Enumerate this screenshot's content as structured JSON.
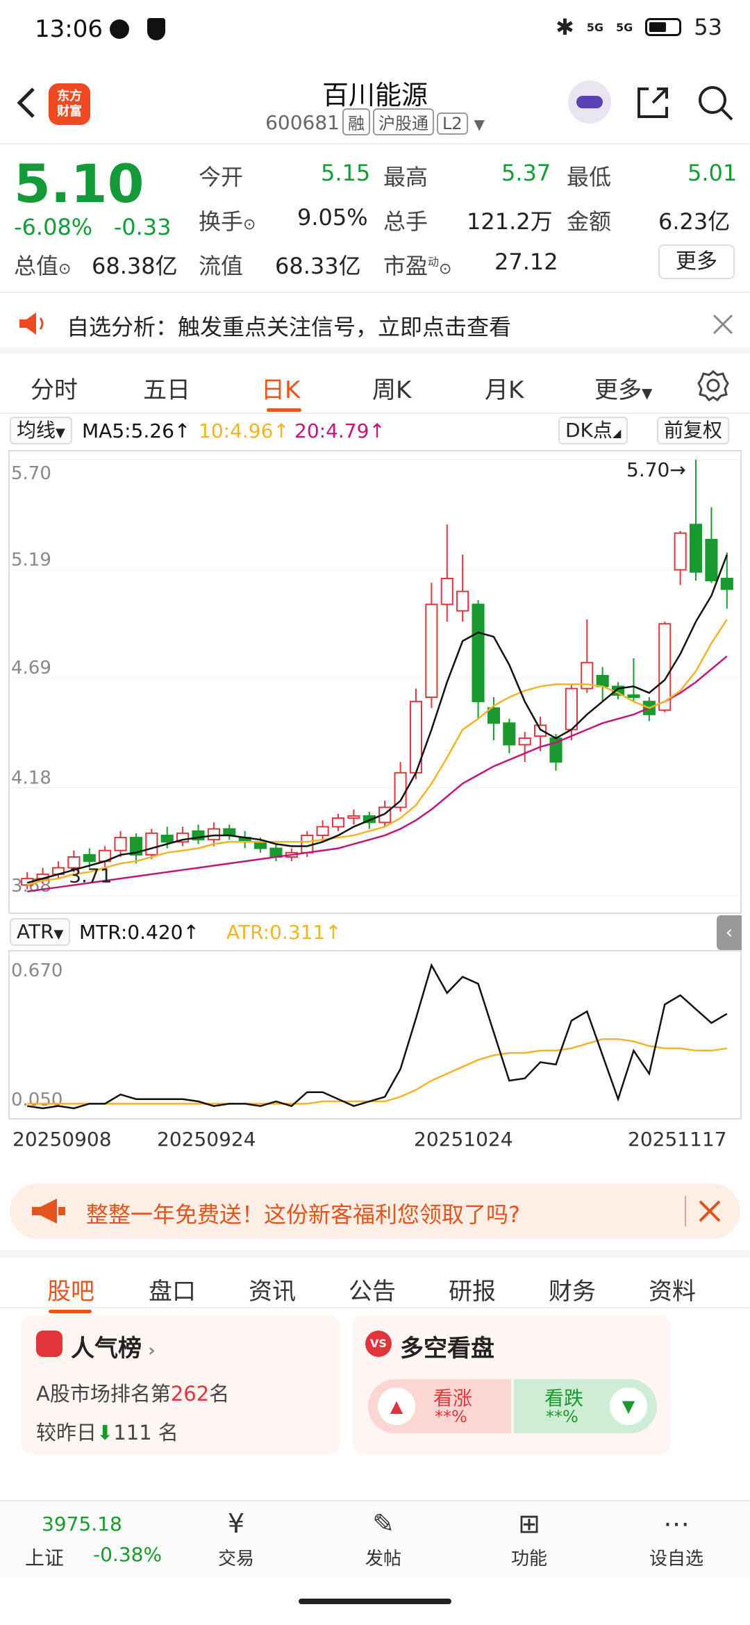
{
  "status": {
    "time": "13:06",
    "battery": "53",
    "net1": "5G",
    "net2": "5G"
  },
  "header": {
    "title": "百川能源",
    "code": "600681",
    "tags": [
      "融",
      "沪股通",
      "L2"
    ],
    "logo_line1": "东方",
    "logo_line2": "财富"
  },
  "quote": {
    "price": "5.10",
    "change_pct": "-6.08%",
    "change_abs": "-0.33",
    "open_label": "今开",
    "open": "5.15",
    "high_label": "最高",
    "high": "5.37",
    "low_label": "最低",
    "low": "5.01",
    "turnover_label": "换手",
    "turnover": "9.05%",
    "volume_label": "总手",
    "volume": "121.2万",
    "amount_label": "金额",
    "amount": "6.23亿",
    "mcap_label": "总值",
    "mcap": "68.38亿",
    "float_label": "流值",
    "float": "68.33亿",
    "pe_label": "市盈",
    "pe_sup": "动",
    "pe": "27.12",
    "more": "更多"
  },
  "notice": {
    "text": "自选分析：触发重点关注信号，立即点击查看"
  },
  "tabs": [
    "分时",
    "五日",
    "日K",
    "周K",
    "月K",
    "更多"
  ],
  "indicators": {
    "ma_selector": "均线",
    "ma5": "MA5:5.26↑",
    "ma10": "10:4.96↑",
    "ma20": "20:4.79↑",
    "dk": "DK点",
    "adjust": "前复权",
    "colors": {
      "ma5": "#111111",
      "ma10": "#f0b429",
      "ma20": "#c2157a",
      "up": "#e0353b",
      "down": "#1a9a2e"
    }
  },
  "atr": {
    "selector": "ATR",
    "mtr": "MTR:0.420↑",
    "atr": "ATR:0.311↑",
    "y_labels": [
      "0.670",
      "0.050"
    ]
  },
  "date_labels": [
    "20250908",
    "20250924",
    "20251024",
    "20251117"
  ],
  "chart_data": {
    "type": "candlestick",
    "ylim": [
      3.68,
      5.7
    ],
    "y_ticks": [
      "5.70",
      "5.19",
      "4.69",
      "4.18",
      "3.68"
    ],
    "max_label": "5.70→",
    "min_label": "3.71",
    "candles": [
      {
        "o": 3.73,
        "c": 3.76,
        "h": 3.79,
        "l": 3.71
      },
      {
        "o": 3.76,
        "c": 3.78,
        "h": 3.81,
        "l": 3.74
      },
      {
        "o": 3.78,
        "c": 3.81,
        "h": 3.84,
        "l": 3.76
      },
      {
        "o": 3.81,
        "c": 3.86,
        "h": 3.89,
        "l": 3.79
      },
      {
        "o": 3.87,
        "c": 3.84,
        "h": 3.9,
        "l": 3.81
      },
      {
        "o": 3.84,
        "c": 3.89,
        "h": 3.91,
        "l": 3.8
      },
      {
        "o": 3.89,
        "c": 3.95,
        "h": 3.98,
        "l": 3.86
      },
      {
        "o": 3.95,
        "c": 3.87,
        "h": 3.97,
        "l": 3.83
      },
      {
        "o": 3.87,
        "c": 3.97,
        "h": 3.99,
        "l": 3.85
      },
      {
        "o": 3.96,
        "c": 3.93,
        "h": 4.0,
        "l": 3.9
      },
      {
        "o": 3.93,
        "c": 3.97,
        "h": 4.0,
        "l": 3.91
      },
      {
        "o": 3.98,
        "c": 3.94,
        "h": 4.01,
        "l": 3.92
      },
      {
        "o": 3.94,
        "c": 3.99,
        "h": 4.02,
        "l": 3.91
      },
      {
        "o": 3.99,
        "c": 3.96,
        "h": 4.01,
        "l": 3.94
      },
      {
        "o": 3.95,
        "c": 3.93,
        "h": 3.98,
        "l": 3.9
      },
      {
        "o": 3.93,
        "c": 3.9,
        "h": 3.95,
        "l": 3.88
      },
      {
        "o": 3.9,
        "c": 3.86,
        "h": 3.92,
        "l": 3.84
      },
      {
        "o": 3.86,
        "c": 3.88,
        "h": 3.9,
        "l": 3.84
      },
      {
        "o": 3.88,
        "c": 3.96,
        "h": 3.98,
        "l": 3.86
      },
      {
        "o": 3.96,
        "c": 4.0,
        "h": 4.03,
        "l": 3.93
      },
      {
        "o": 4.0,
        "c": 4.04,
        "h": 4.06,
        "l": 3.98
      },
      {
        "o": 4.04,
        "c": 4.05,
        "h": 4.08,
        "l": 4.01
      },
      {
        "o": 4.05,
        "c": 4.02,
        "h": 4.07,
        "l": 3.99
      },
      {
        "o": 4.02,
        "c": 4.09,
        "h": 4.12,
        "l": 4.0
      },
      {
        "o": 4.09,
        "c": 4.25,
        "h": 4.3,
        "l": 4.07
      },
      {
        "o": 4.25,
        "c": 4.58,
        "h": 4.64,
        "l": 4.22
      },
      {
        "o": 4.6,
        "c": 5.03,
        "h": 5.13,
        "l": 4.55
      },
      {
        "o": 5.03,
        "c": 5.15,
        "h": 5.4,
        "l": 4.95
      },
      {
        "o": 5.0,
        "c": 5.09,
        "h": 5.26,
        "l": 4.95
      },
      {
        "o": 5.03,
        "c": 4.58,
        "h": 5.05,
        "l": 4.5
      },
      {
        "o": 4.55,
        "c": 4.48,
        "h": 4.6,
        "l": 4.4
      },
      {
        "o": 4.48,
        "c": 4.38,
        "h": 4.5,
        "l": 4.34
      },
      {
        "o": 4.38,
        "c": 4.41,
        "h": 4.44,
        "l": 4.3
      },
      {
        "o": 4.42,
        "c": 4.47,
        "h": 4.51,
        "l": 4.35
      },
      {
        "o": 4.41,
        "c": 4.3,
        "h": 4.43,
        "l": 4.26
      },
      {
        "o": 4.45,
        "c": 4.64,
        "h": 4.66,
        "l": 4.4
      },
      {
        "o": 4.64,
        "c": 4.76,
        "h": 4.96,
        "l": 4.62
      },
      {
        "o": 4.7,
        "c": 4.65,
        "h": 4.74,
        "l": 4.58
      },
      {
        "o": 4.65,
        "c": 4.61,
        "h": 4.67,
        "l": 4.59
      },
      {
        "o": 4.61,
        "c": 4.6,
        "h": 4.78,
        "l": 4.58
      },
      {
        "o": 4.58,
        "c": 4.52,
        "h": 4.6,
        "l": 4.49
      },
      {
        "o": 4.54,
        "c": 4.94,
        "h": 4.95,
        "l": 4.53
      },
      {
        "o": 5.19,
        "c": 5.36,
        "h": 5.37,
        "l": 5.12
      },
      {
        "o": 5.4,
        "c": 5.18,
        "h": 5.7,
        "l": 5.14
      },
      {
        "o": 5.33,
        "c": 5.14,
        "h": 5.48,
        "l": 5.13
      },
      {
        "o": 5.15,
        "c": 5.1,
        "h": 5.27,
        "l": 5.01
      }
    ],
    "ma5": [
      3.74,
      3.76,
      3.78,
      3.8,
      3.82,
      3.84,
      3.87,
      3.88,
      3.9,
      3.92,
      3.94,
      3.95,
      3.96,
      3.96,
      3.95,
      3.94,
      3.92,
      3.91,
      3.91,
      3.93,
      3.96,
      4.0,
      4.03,
      4.06,
      4.12,
      4.25,
      4.45,
      4.67,
      4.86,
      4.9,
      4.88,
      4.75,
      4.58,
      4.45,
      4.41,
      4.45,
      4.52,
      4.58,
      4.64,
      4.65,
      4.62,
      4.68,
      4.8,
      4.95,
      5.07,
      5.26
    ],
    "ma10": [
      3.73,
      3.75,
      3.76,
      3.78,
      3.79,
      3.81,
      3.83,
      3.84,
      3.86,
      3.88,
      3.89,
      3.9,
      3.92,
      3.93,
      3.93,
      3.93,
      3.93,
      3.93,
      3.93,
      3.94,
      3.95,
      3.96,
      3.98,
      4.0,
      4.04,
      4.1,
      4.2,
      4.32,
      4.45,
      4.5,
      4.56,
      4.6,
      4.63,
      4.65,
      4.66,
      4.66,
      4.66,
      4.65,
      4.62,
      4.58,
      4.55,
      4.58,
      4.63,
      4.72,
      4.85,
      4.96
    ],
    "ma20": [
      3.7,
      3.71,
      3.72,
      3.73,
      3.74,
      3.75,
      3.76,
      3.77,
      3.78,
      3.79,
      3.8,
      3.81,
      3.82,
      3.83,
      3.84,
      3.85,
      3.86,
      3.87,
      3.88,
      3.89,
      3.9,
      3.92,
      3.94,
      3.96,
      3.99,
      4.03,
      4.08,
      4.14,
      4.2,
      4.24,
      4.28,
      4.31,
      4.34,
      4.37,
      4.39,
      4.42,
      4.45,
      4.48,
      4.5,
      4.52,
      4.55,
      4.58,
      4.62,
      4.67,
      4.73,
      4.79
    ],
    "atr_ylim": [
      0.05,
      0.67
    ],
    "mtr": [
      0.06,
      0.05,
      0.06,
      0.05,
      0.07,
      0.07,
      0.11,
      0.09,
      0.09,
      0.09,
      0.09,
      0.08,
      0.06,
      0.07,
      0.07,
      0.06,
      0.08,
      0.06,
      0.12,
      0.12,
      0.09,
      0.06,
      0.08,
      0.1,
      0.22,
      0.44,
      0.67,
      0.55,
      0.62,
      0.59,
      0.38,
      0.17,
      0.18,
      0.25,
      0.24,
      0.43,
      0.47,
      0.28,
      0.09,
      0.3,
      0.2,
      0.5,
      0.54,
      0.48,
      0.42,
      0.46
    ],
    "atr": [
      0.07,
      0.07,
      0.07,
      0.07,
      0.07,
      0.07,
      0.07,
      0.07,
      0.07,
      0.07,
      0.07,
      0.07,
      0.07,
      0.07,
      0.07,
      0.07,
      0.07,
      0.07,
      0.07,
      0.08,
      0.08,
      0.08,
      0.08,
      0.08,
      0.1,
      0.13,
      0.17,
      0.2,
      0.23,
      0.26,
      0.28,
      0.29,
      0.29,
      0.3,
      0.3,
      0.31,
      0.33,
      0.35,
      0.35,
      0.34,
      0.32,
      0.31,
      0.31,
      0.3,
      0.3,
      0.31
    ]
  },
  "ad": {
    "text": "整整一年免费送！这份新客福利您领取了吗?"
  },
  "bottom_tabs": [
    "股吧",
    "盘口",
    "资讯",
    "公告",
    "研报",
    "财务",
    "资料"
  ],
  "cards": {
    "popularity_title": "人气榜",
    "rank_prefix": "A股市场排名第",
    "rank_value": "262",
    "rank_suffix": "名",
    "prev_prefix": "较昨日",
    "prev_value": "111",
    "prev_suffix": "名",
    "vs_title": "多空看盘",
    "bull": "看涨",
    "bear": "看跌",
    "pct": "**%"
  },
  "nav": {
    "index_value": "3975.18",
    "index_name": "上证",
    "index_change": "-0.38%",
    "items": [
      "交易",
      "发帖",
      "功能",
      "设自选"
    ]
  }
}
